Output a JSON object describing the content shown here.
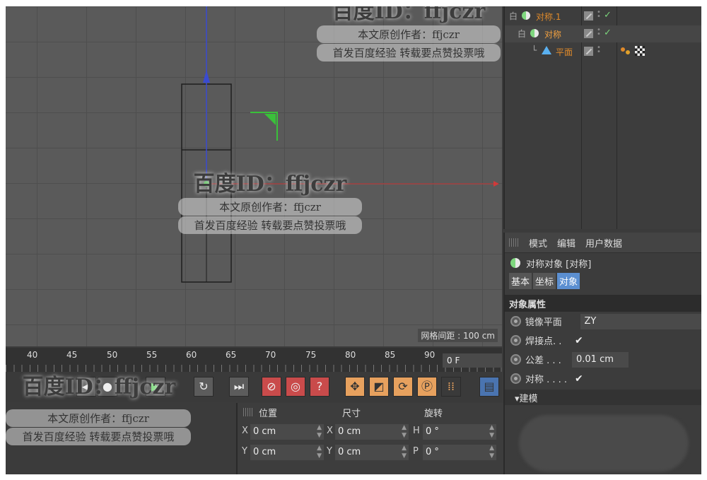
{
  "watermark": {
    "id_big": "百度ID：ffjczr",
    "author": "本文原创作者：ffjczr",
    "promo": "首发百度经验 转载要点赞投票哦"
  },
  "viewport": {
    "grid_spacing": "网格间距 : 100 cm"
  },
  "object_manager": {
    "rows": [
      {
        "name": "对称.1",
        "tree": "白"
      },
      {
        "name": "对称",
        "tree": "白"
      },
      {
        "name": "平面",
        "tree": "└"
      }
    ]
  },
  "attribute_manager": {
    "menu": [
      "模式",
      "编辑",
      "用户数据"
    ],
    "object_title": "对称对象 [对称]",
    "tabs": [
      "基本",
      "坐标",
      "对象"
    ],
    "section_title": "对象属性",
    "props": {
      "mirror_plane_label": "镜像平面",
      "mirror_plane_value": "ZY",
      "weld_label": "焊接点. .",
      "tolerance_label": "公差 . . .",
      "tolerance_value": "0.01 cm",
      "symmetry_label": "对称 . . . .",
      "check": "✔"
    },
    "subsection": "▾建模"
  },
  "timeline": {
    "ticks": [
      "40",
      "45",
      "50",
      "55",
      "60",
      "65",
      "70",
      "75",
      "80",
      "85",
      "90"
    ],
    "frame": "0 F"
  },
  "coords": {
    "headers": [
      "位置",
      "尺寸",
      "旋转"
    ],
    "rows": [
      {
        "a": "X",
        "av": "0 cm",
        "b": "X",
        "bv": "0 cm",
        "c": "H",
        "cv": "0 °"
      },
      {
        "a": "Y",
        "av": "0 cm",
        "b": "Y",
        "bv": "0 cm",
        "c": "P",
        "cv": "0 °"
      }
    ]
  },
  "colors": {
    "accent_blue": "#5b8fd1",
    "object_orange": "#e08a2a",
    "axis_red": "#d03a3a",
    "axis_blue": "#3a4bd0",
    "axis_green": "#3ac03a"
  }
}
